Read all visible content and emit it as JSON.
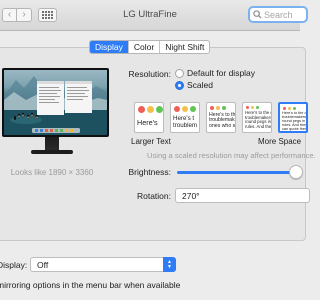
{
  "window": {
    "title": "LG UltraFine",
    "search_placeholder": "Search"
  },
  "tabs": [
    {
      "label": "Display",
      "active": true
    },
    {
      "label": "Color",
      "active": false
    },
    {
      "label": "Night Shift",
      "active": false
    }
  ],
  "display": {
    "looks_like": "Looks like 1890 × 3360",
    "resolution_label": "Resolution:",
    "resolution_options": [
      {
        "label": "Default for display",
        "selected": false
      },
      {
        "label": "Scaled",
        "selected": true
      }
    ],
    "scaling_options": [
      {
        "text": "Here's",
        "selected": false
      },
      {
        "text": "Here's t\ntroublem",
        "selected": false
      },
      {
        "text": "Here's to th\ntroublemak\nones who se",
        "selected": false
      },
      {
        "text": "Here's to the c\ntroublemakers\nround pegs in\nrules. And the",
        "selected": false
      },
      {
        "text": "Here's to the cr\ntroublemakers. T\nround pegs in th\nrules. And they h\ncan quote them,\nthing you can't d",
        "selected": true
      }
    ],
    "larger_text_label": "Larger Text",
    "more_space_label": "More Space",
    "scaled_note": "Using a scaled resolution may affect performance.",
    "brightness_label": "Brightness:",
    "brightness_level": 0.95,
    "rotation_label": "Rotation:",
    "rotation_value": "270°"
  },
  "airplay": {
    "label": "Display:",
    "value": "Off",
    "mirroring_text": "mirroring options in the menu bar when available"
  },
  "colors": {
    "accent": "#2e7cf6",
    "dot_red": "#ee5f57",
    "dot_yellow": "#f5bf4f",
    "dot_green": "#61c454"
  }
}
